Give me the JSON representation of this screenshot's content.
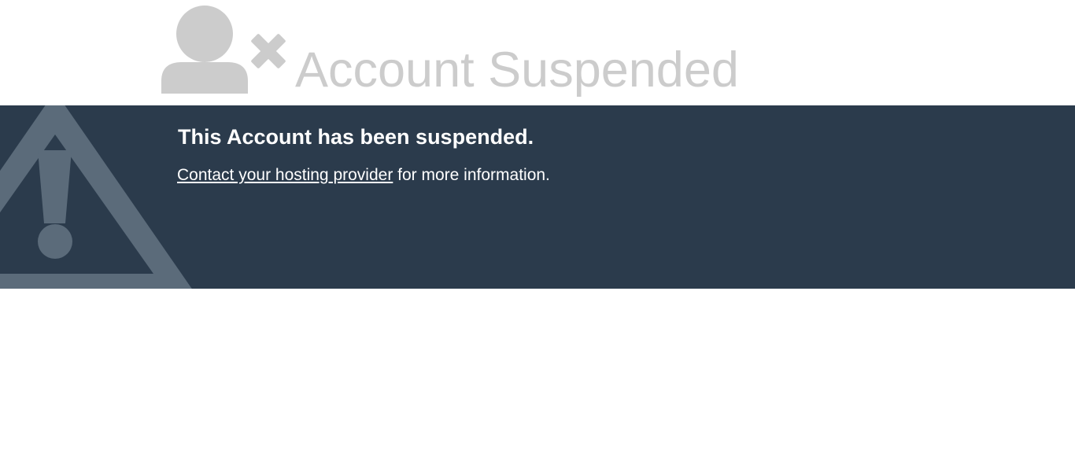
{
  "header": {
    "title": "Account Suspended",
    "icon": "user-x-icon",
    "icon_color": "#cccccc"
  },
  "banner": {
    "background_color": "#2b3b4c",
    "icon": "warning-triangle-icon",
    "icon_color": "#5b6b7a",
    "heading": "This Account has been suspended.",
    "link_text": "Contact your hosting provider",
    "body_suffix": " for more information."
  }
}
